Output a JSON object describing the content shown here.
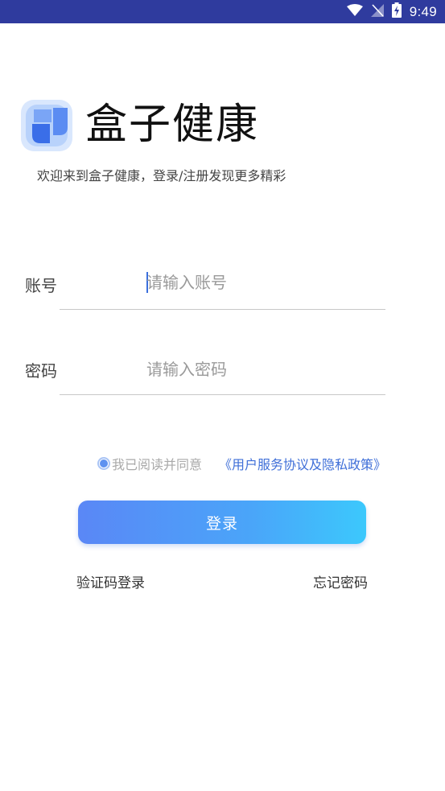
{
  "status_bar": {
    "time": "9:49",
    "icons": [
      "wifi-icon",
      "no-signal-icon",
      "battery-charging-icon"
    ],
    "background": "#2f3b9e"
  },
  "header": {
    "logo_icon": "box-logo-icon",
    "app_name": "盒子健康",
    "welcome": "欢迎来到盒子健康，登录/注册发现更多精彩"
  },
  "form": {
    "account": {
      "label": "账号",
      "placeholder": "请输入账号",
      "value": ""
    },
    "password": {
      "label": "密码",
      "placeholder": "请输入密码",
      "value": ""
    }
  },
  "agreement": {
    "checked": true,
    "text": "我已阅读并同意",
    "link": "《用户服务协议及隐私政策》",
    "link_color": "#3f6fd8"
  },
  "login_button": {
    "label": "登录",
    "gradient": [
      "#5a87f6",
      "#3cc8fc"
    ]
  },
  "links": {
    "sms_login": "验证码登录",
    "forgot_password": "忘记密码"
  }
}
